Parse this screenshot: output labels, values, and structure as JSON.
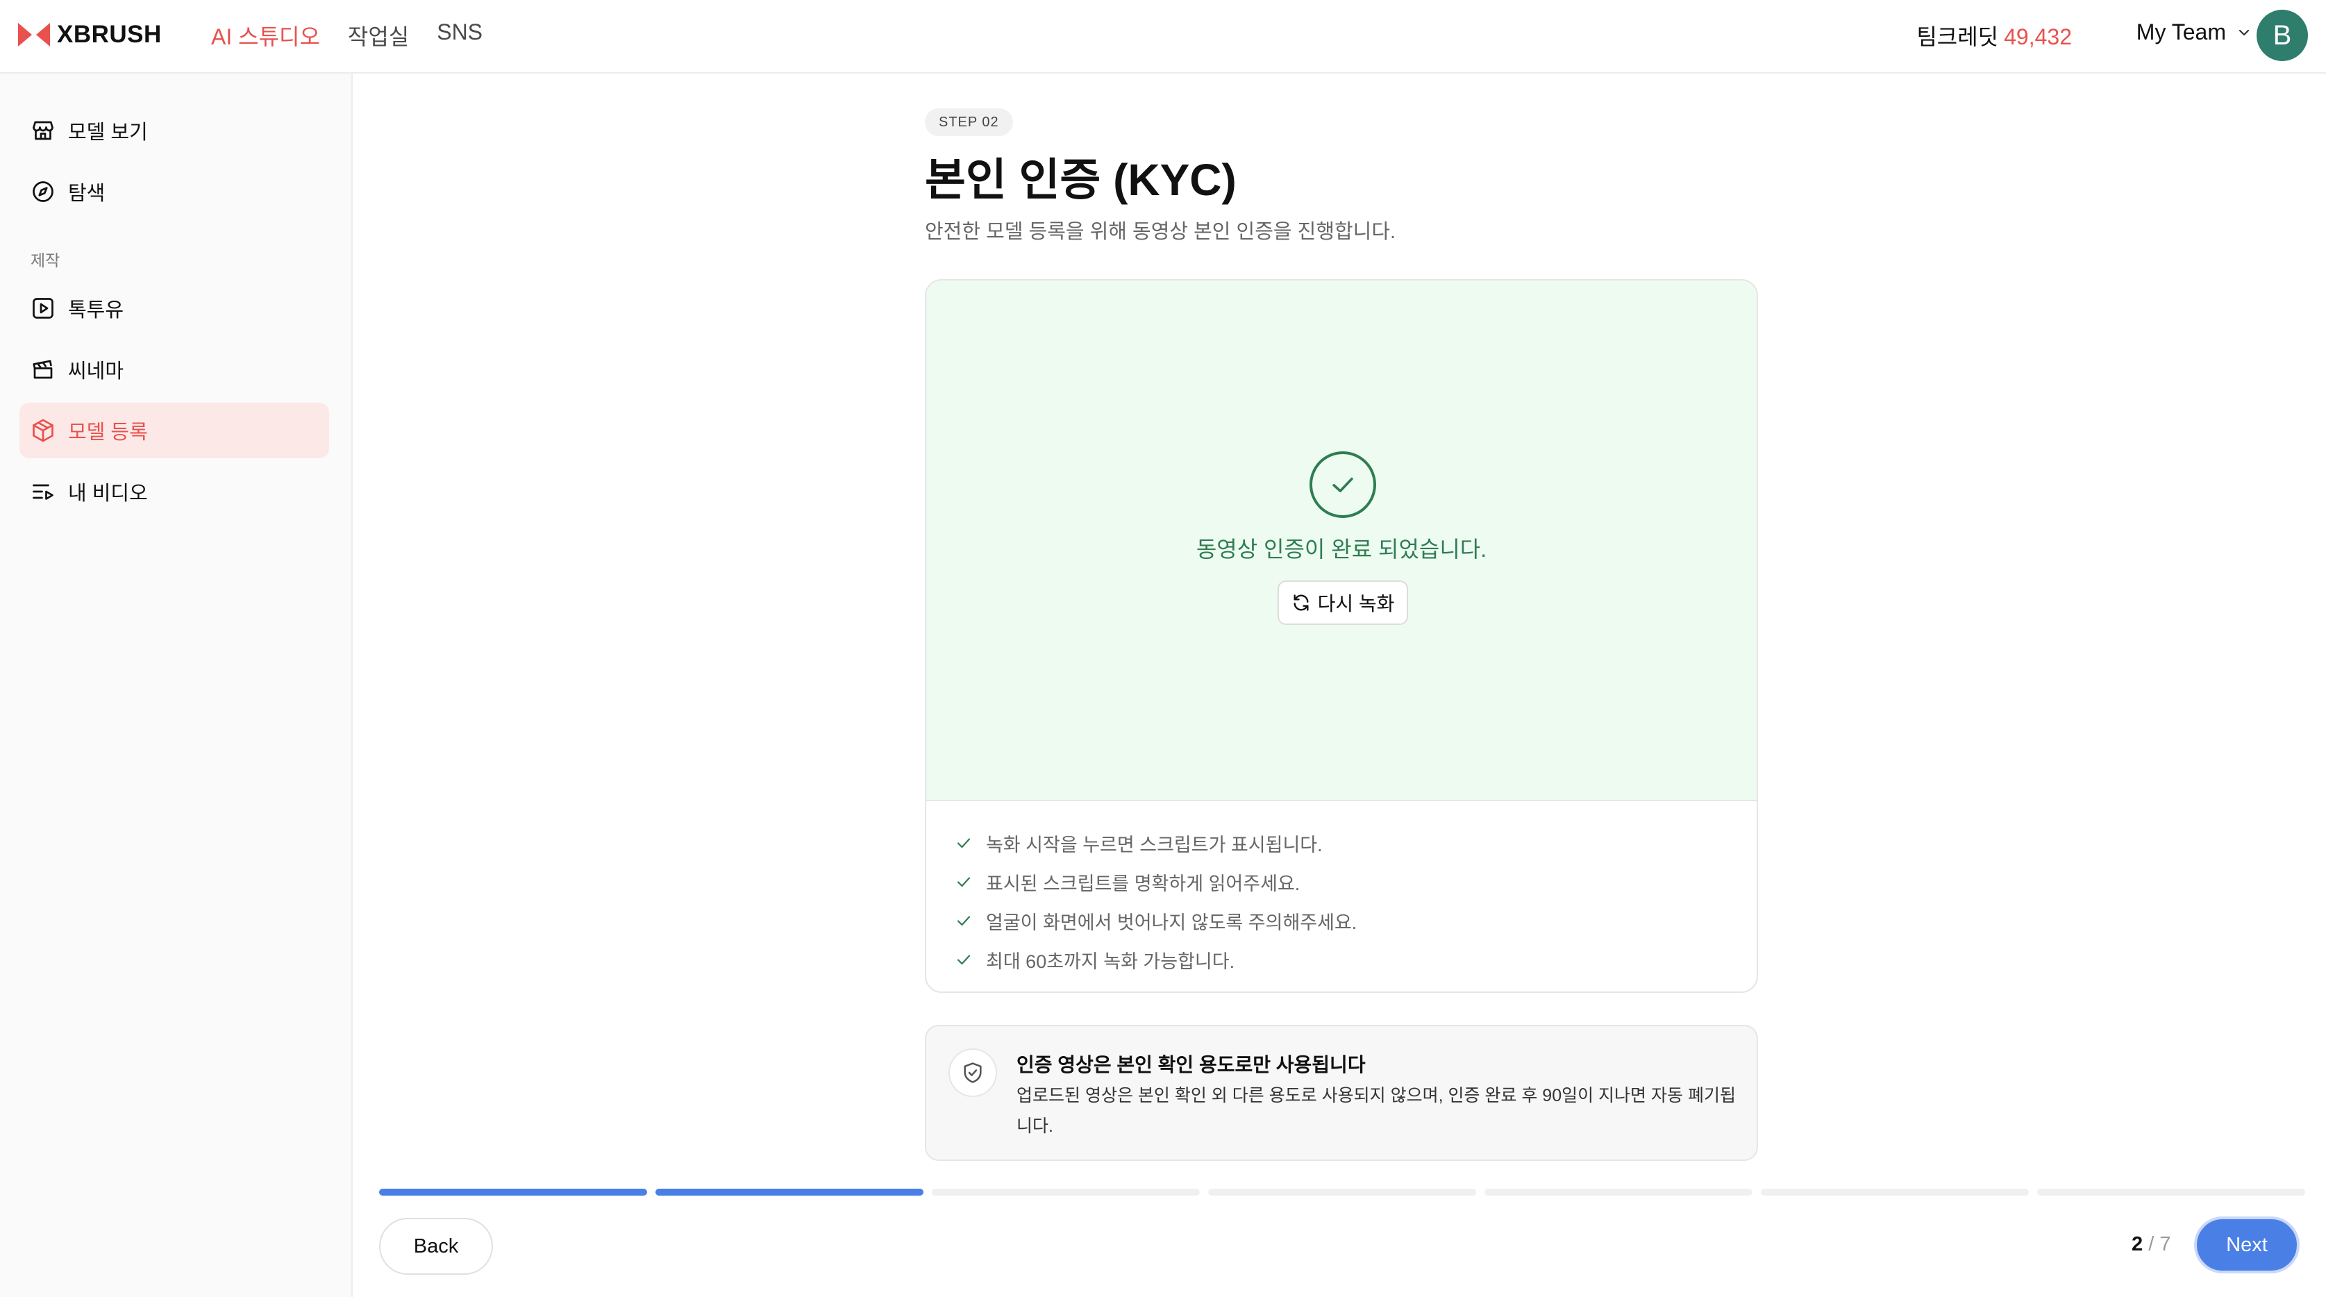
{
  "brand": {
    "name": "XBRUSH",
    "accent": "#e8514d"
  },
  "topnav": [
    {
      "label": "AI 스튜디오",
      "active": true
    },
    {
      "label": "작업실",
      "active": false
    },
    {
      "label": "SNS",
      "active": false
    }
  ],
  "header": {
    "credits_label": "팀크레딧",
    "credits_value": "49,432",
    "team_label": "My Team",
    "avatar_letter": "B"
  },
  "sidebar": {
    "items_top": [
      {
        "label": "모델 보기",
        "icon": "store-icon"
      },
      {
        "label": "탐색",
        "icon": "compass-icon"
      }
    ],
    "section_label": "제작",
    "items_create": [
      {
        "label": "톡투유",
        "icon": "play-square-icon"
      },
      {
        "label": "씨네마",
        "icon": "clapperboard-icon"
      },
      {
        "label": "모델 등록",
        "icon": "box-icon",
        "active": true
      },
      {
        "label": "내 비디오",
        "icon": "list-video-icon"
      }
    ]
  },
  "step": {
    "badge": "STEP 02",
    "title": "본인 인증 (KYC)",
    "subtitle": "안전한 모델 등록을 위해 동영상 본인 인증을 진행합니다."
  },
  "kyc": {
    "success_text": "동영상 인증이 완료 되었습니다.",
    "rerecord_label": "다시 녹화",
    "tips": [
      "녹화 시작을 누르면 스크립트가 표시됩니다.",
      "표시된 스크립트를 명확하게 읽어주세요.",
      "얼굴이 화면에서 벗어나지 않도록 주의해주세요.",
      "최대 60초까지 녹화 가능합니다."
    ]
  },
  "notice": {
    "title": "인증 영상은 본인 확인 용도로만 사용됩니다",
    "body": "업로드된 영상은 본인 확인 외 다른 용도로 사용되지 않으며, 인증 완료 후 90일이 지나면 자동 폐기됩니다."
  },
  "footer": {
    "back_label": "Back",
    "next_label": "Next",
    "current_step": "2",
    "total_steps": "7",
    "progress_completed": 2,
    "progress_total": 7
  }
}
